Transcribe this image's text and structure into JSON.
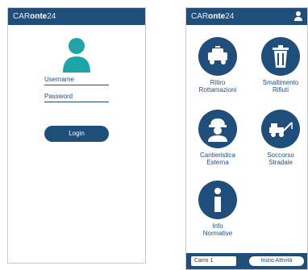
{
  "login_screen": {
    "brand_light": "CAR",
    "brand_bold": "onte",
    "brand_num": "24",
    "username_label": "Username",
    "password_label": "Password",
    "login_label": "Login"
  },
  "menu_screen": {
    "brand_light": "CAR",
    "brand_bold": "onte",
    "brand_num": "24",
    "tiles": [
      {
        "line1": "Ritiro",
        "line2": "Rottamazioni",
        "icon": "truck-icon"
      },
      {
        "line1": "Smaltimento",
        "line2": "Rifiuti",
        "icon": "trash-icon"
      },
      {
        "line1": "Cantieristica",
        "line2": "Esterna",
        "icon": "worker-icon"
      },
      {
        "line1": "Soccorso",
        "line2": "Stradale",
        "icon": "tow-truck-icon"
      },
      {
        "line1": "Info",
        "line2": "Normative",
        "icon": "info-icon"
      }
    ],
    "footer": {
      "carro_value": "Carro 1",
      "start_label": "Inizio Attività"
    }
  },
  "colors": {
    "primary": "#1f4e7a",
    "accent": "#1fa5a7"
  }
}
